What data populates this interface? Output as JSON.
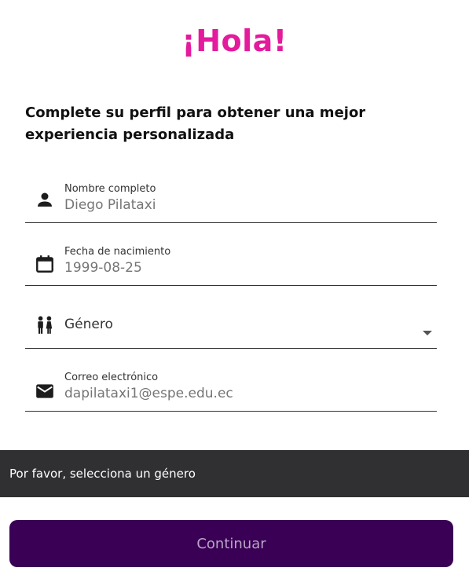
{
  "header": {
    "title": "¡Hola!",
    "subtitle": "Complete su perfil para obtener una mejor experiencia personalizada"
  },
  "form": {
    "name": {
      "label": "Nombre completo",
      "placeholder": "Diego Pilataxi",
      "icon": "person-icon"
    },
    "birthdate": {
      "label": "Fecha de nacimiento",
      "placeholder": "1999-08-25",
      "icon": "calendar-icon"
    },
    "gender": {
      "selected": "Género",
      "icon": "gender-icon"
    },
    "email": {
      "label": "Correo electrónico",
      "placeholder": "dapilataxi1@espe.edu.ec",
      "icon": "mail-icon"
    }
  },
  "snackbar": {
    "message": "Por favor, selecciona un género"
  },
  "actions": {
    "continue_label": "Continuar"
  },
  "colors": {
    "title": "#e31b9c",
    "button_bg": "#3a0055",
    "button_text": "#b7a6c6",
    "snackbar_bg": "#303032"
  }
}
